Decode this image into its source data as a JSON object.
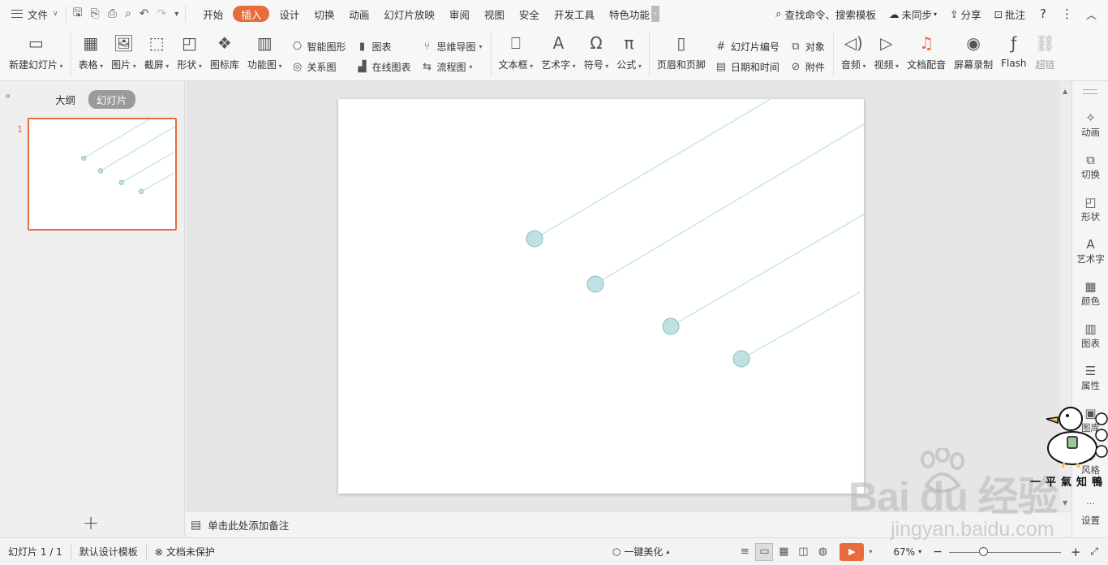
{
  "menubar": {
    "file_label": "文件",
    "tabs": [
      {
        "label": "开始"
      },
      {
        "label": "插入",
        "active": true
      },
      {
        "label": "设计"
      },
      {
        "label": "切换"
      },
      {
        "label": "动画"
      },
      {
        "label": "幻灯片放映"
      },
      {
        "label": "审阅"
      },
      {
        "label": "视图"
      },
      {
        "label": "安全"
      },
      {
        "label": "开发工具"
      },
      {
        "label": "特色功能"
      }
    ],
    "search_label": "查找命令、搜索模板",
    "sync_label": "未同步",
    "share_label": "分享",
    "comment_label": "批注"
  },
  "ribbon": {
    "new_slide": "新建幻灯片",
    "table": "表格",
    "picture": "图片",
    "screenshot": "截屏",
    "shape": "形状",
    "icon_lib": "图标库",
    "function_chart": "功能图",
    "smart_art": "智能图形",
    "chart": "图表",
    "relation": "关系图",
    "online_chart": "在线图表",
    "mindmap": "思维导图",
    "flowchart": "流程图",
    "textbox": "文本框",
    "wordart": "艺术字",
    "symbol": "符号",
    "formula": "公式",
    "header_footer": "页眉和页脚",
    "slide_number": "幻灯片编号",
    "object": "对象",
    "datetime": "日期和时间",
    "attachment": "附件",
    "audio": "音频",
    "video": "视频",
    "doc_voice": "文档配音",
    "screen_record": "屏幕录制",
    "flash": "Flash",
    "hyperlink": "超链"
  },
  "leftpanel": {
    "tab_outline": "大纲",
    "tab_slides": "幻灯片",
    "slide_number": "1",
    "add_symbol": "+"
  },
  "notes": {
    "placeholder": "单击此处添加备注"
  },
  "rightbar": {
    "items": [
      {
        "label": "动画"
      },
      {
        "label": "切换"
      },
      {
        "label": "形状"
      },
      {
        "label": "艺术字"
      },
      {
        "label": "颜色"
      },
      {
        "label": "图表"
      },
      {
        "label": "属性"
      },
      {
        "label": "图库"
      },
      {
        "label": "风格"
      },
      {
        "label": "设置"
      }
    ],
    "more": "···"
  },
  "statusbar": {
    "slide_info": "幻灯片 1 / 1",
    "template": "默认设计模板",
    "protect": "文档未保护",
    "beautify": "一键美化",
    "zoom": "67%",
    "zoom_level": 0.29
  },
  "watermark": {
    "baidu": "Bai  du 经验",
    "url": "jingyan.baidu.com",
    "mascot_text": "一平氣知鴨"
  },
  "colors": {
    "accent": "#e86b3c",
    "slide_line": "#b9e2e4",
    "slide_dot_fill": "#bfe1e3",
    "slide_dot_stroke": "#8bbdc1"
  },
  "icons": {
    "qa": [
      "save-icon",
      "export-icon",
      "print-icon",
      "preview-icon",
      "undo-icon",
      "redo-icon",
      "customize-icon"
    ]
  }
}
